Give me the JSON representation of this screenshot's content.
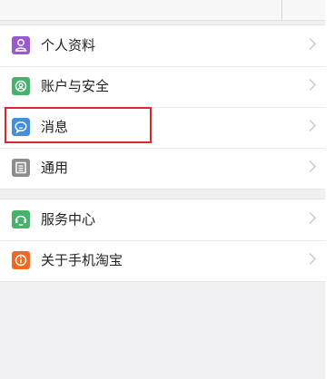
{
  "header": {
    "title_fragment": "",
    "right_fragment": ""
  },
  "colors": {
    "profile": "#9b59d0",
    "security": "#45b36b",
    "messages": "#3f8fe0",
    "general": "#8d8d8d",
    "service": "#45b36b",
    "about": "#f5671f",
    "highlight": "#d8272d"
  },
  "settings_group": {
    "items": [
      {
        "label": "个人资料",
        "icon": "profile-icon"
      },
      {
        "label": "账户与安全",
        "icon": "security-icon"
      },
      {
        "label": "消息",
        "icon": "message-icon"
      },
      {
        "label": "通用",
        "icon": "general-icon"
      }
    ]
  },
  "support_group": {
    "items": [
      {
        "label": "服务中心",
        "icon": "service-icon"
      },
      {
        "label": "关于手机淘宝",
        "icon": "about-icon"
      }
    ]
  }
}
